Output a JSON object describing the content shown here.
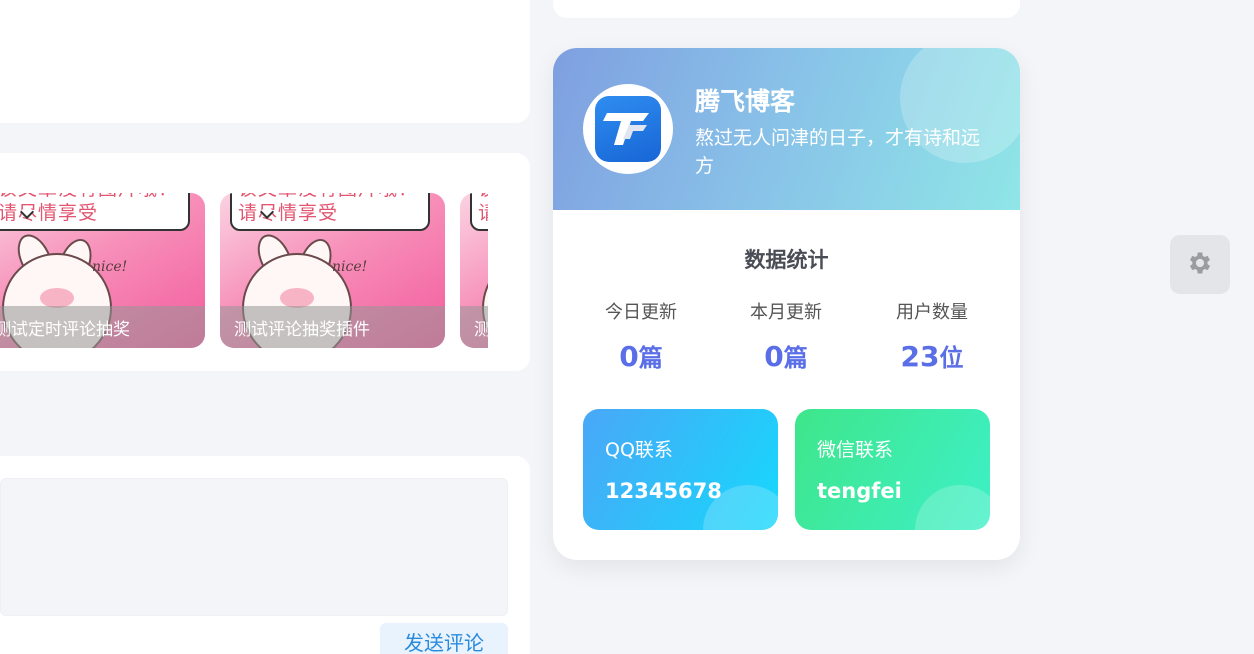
{
  "related_posts": {
    "thumb_banner_text": "该文章没有图片哦！\n请尽情享受",
    "thumb_sticker_text": "nice!",
    "items": [
      {
        "caption": "测试定时评论抽奖"
      },
      {
        "caption": "测试评论抽奖插件"
      },
      {
        "caption": "测试"
      }
    ]
  },
  "comment": {
    "send_label": "发送评论"
  },
  "author": {
    "name": "腾飞博客",
    "motto": "熬过无人问津的日子，才有诗和远方",
    "avatar_icon": "tf-logo-icon"
  },
  "stats": {
    "title": "数据统计",
    "items": [
      {
        "label": "今日更新",
        "value": "0",
        "unit": "篇"
      },
      {
        "label": "本月更新",
        "value": "0",
        "unit": "篇"
      },
      {
        "label": "用户数量",
        "value": "23",
        "unit": "位"
      }
    ]
  },
  "contacts": {
    "qq": {
      "label": "QQ联系",
      "value": "12345678"
    },
    "wechat": {
      "label": "微信联系",
      "value": "tengfei"
    }
  },
  "settings": {
    "icon": "gear-icon"
  }
}
